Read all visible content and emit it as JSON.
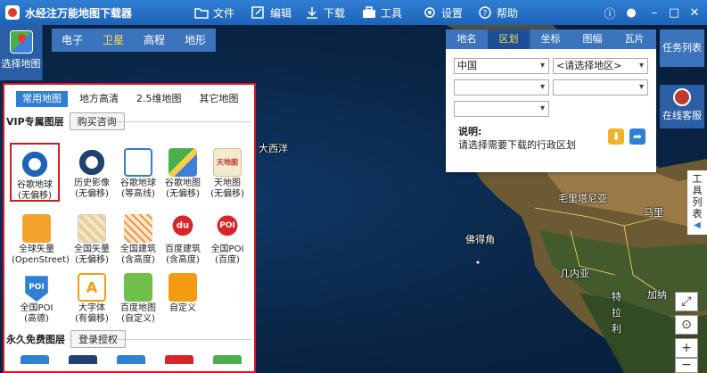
{
  "app": {
    "title": "水经注万能地图下载器"
  },
  "menu": [
    {
      "label": "文件",
      "icon": "folder-icon"
    },
    {
      "label": "编辑",
      "icon": "edit-icon"
    },
    {
      "label": "下载",
      "icon": "download-icon"
    },
    {
      "label": "工具",
      "icon": "toolbox-icon"
    },
    {
      "label": "设置",
      "icon": "gear-icon"
    },
    {
      "label": "帮助",
      "icon": "help-icon"
    }
  ],
  "select_map": {
    "label": "选择地图"
  },
  "map_tabs": [
    {
      "label": "电子"
    },
    {
      "label": "卫星",
      "active": true
    },
    {
      "label": "高程"
    },
    {
      "label": "地形"
    }
  ],
  "layer_panel": {
    "tabs": [
      {
        "label": "常用地图",
        "active": true
      },
      {
        "label": "地方高清"
      },
      {
        "label": "2.5维地图"
      },
      {
        "label": "其它地图"
      }
    ],
    "vip": {
      "title": "VIP专属图层",
      "button": "购买咨询",
      "items": [
        {
          "l1": "谷歌地球",
          "l2": "(无偏移)",
          "icon": "google-earth-icon",
          "selected": true
        },
        {
          "l1": "历史影像",
          "l2": "(无偏移)",
          "icon": "history-imagery-icon"
        },
        {
          "l1": "谷歌地球",
          "l2": "(等高线)",
          "icon": "contour-icon"
        },
        {
          "l1": "谷歌地图",
          "l2": "(无偏移)",
          "icon": "google-map-icon"
        },
        {
          "l1": "天地图",
          "l2": "(无偏移)",
          "icon": "tianditu-icon",
          "text": "天地图"
        },
        {
          "l1": "全球矢量",
          "l2": "(OpenStreet)",
          "icon": "openstreet-icon"
        },
        {
          "l1": "全国矢量",
          "l2": "(无偏移)",
          "icon": "vector-map-icon"
        },
        {
          "l1": "全国建筑",
          "l2": "(含高度)",
          "icon": "building-icon"
        },
        {
          "l1": "百度建筑",
          "l2": "(含高度)",
          "icon": "baidu-building-icon",
          "text": "du"
        },
        {
          "l1": "全国POI",
          "l2": "(百度)",
          "icon": "poi-baidu-icon",
          "text": "POI"
        },
        {
          "l1": "全国POI",
          "l2": "(高德)",
          "icon": "poi-gaode-icon",
          "text": "POI"
        },
        {
          "l1": "大字体",
          "l2": "(有偏移)",
          "icon": "large-font-icon",
          "text": "A"
        },
        {
          "l1": "百度地图",
          "l2": "(自定义)",
          "icon": "baidu-custom-icon"
        },
        {
          "l1": "自定义",
          "l2": "",
          "icon": "custom-pencil-icon"
        }
      ]
    },
    "free": {
      "title": "永久免费图层",
      "button": "登录授权"
    }
  },
  "region_panel": {
    "tabs": [
      {
        "label": "地名"
      },
      {
        "label": "区划",
        "active": true
      },
      {
        "label": "坐标"
      },
      {
        "label": "图幅"
      },
      {
        "label": "瓦片"
      }
    ],
    "country": "中国",
    "area_placeholder": "<请选择地区>",
    "desc_title": "说明:",
    "desc_text": "请选择需要下载的行政区划"
  },
  "side": {
    "task_list": "任务列表",
    "support": "在线客服",
    "tools": [
      "工",
      "具",
      "列",
      "表"
    ]
  },
  "map_labels": [
    {
      "text": "大西洋"
    },
    {
      "text": "毛里塔尼亚"
    },
    {
      "text": "马里"
    },
    {
      "text": "佛得角"
    },
    {
      "text": "几内亚"
    },
    {
      "text": "特"
    },
    {
      "text": "拉"
    },
    {
      "text": "加纳"
    },
    {
      "text": "利"
    }
  ],
  "colors": {
    "titlebar": "#2f7fd4",
    "highlight": "#d4181e",
    "active_tab": "#ffe24a"
  }
}
